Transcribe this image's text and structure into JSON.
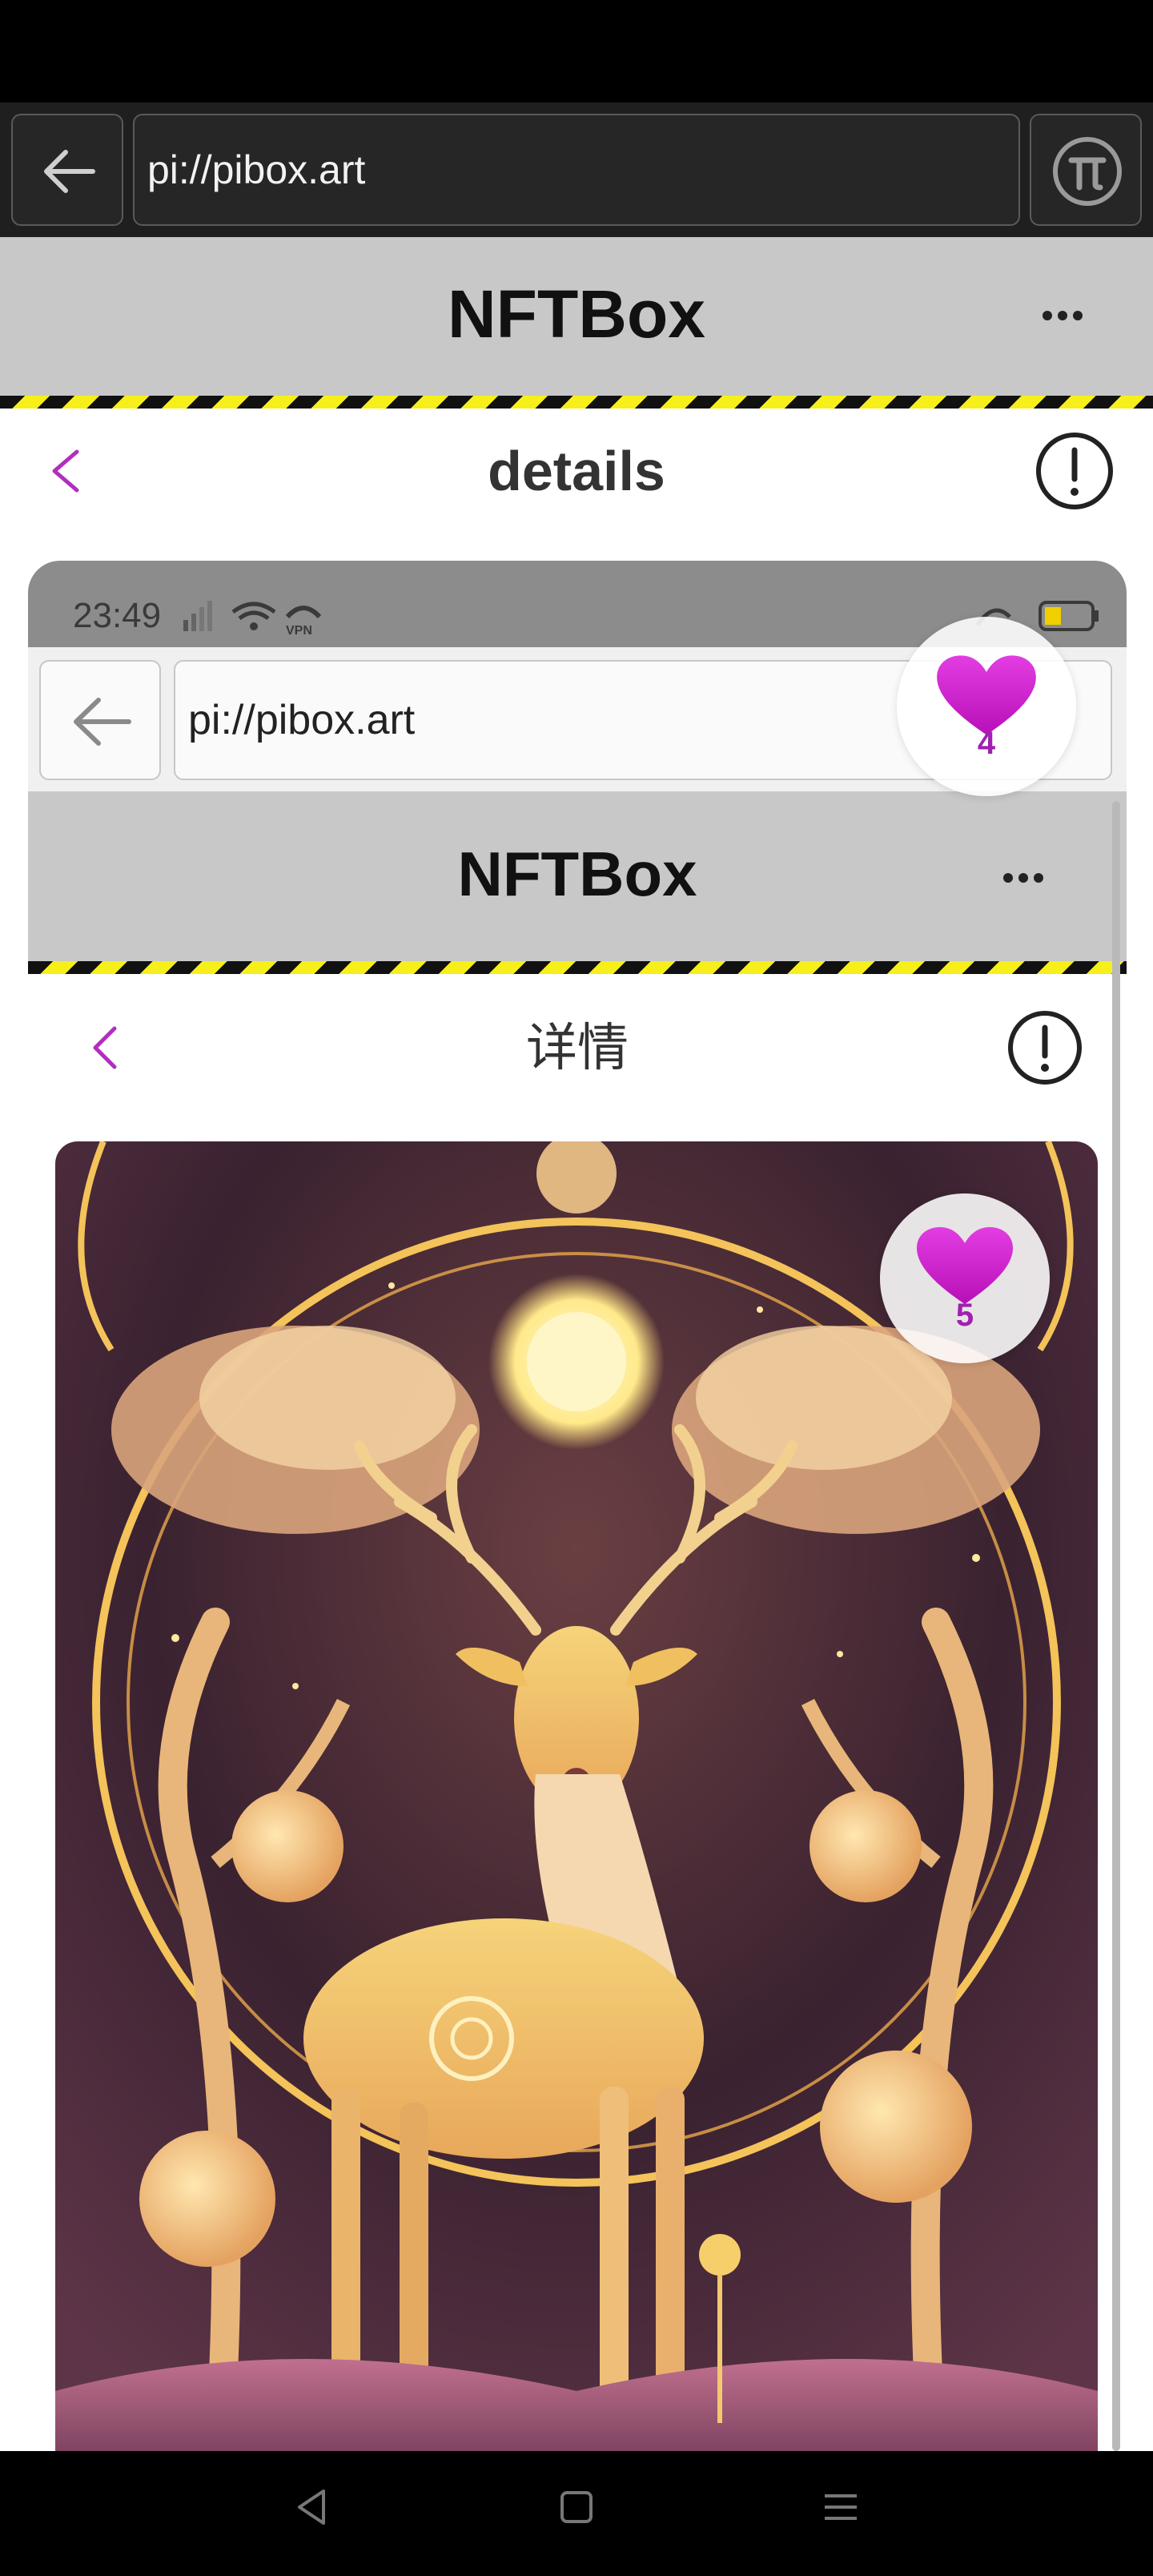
{
  "browser": {
    "url": "pi://pibox.art"
  },
  "app": {
    "title": "NFTBox",
    "page_title": "details"
  },
  "inner_screenshot": {
    "time": "23:49",
    "url": "pi://pibox.art",
    "app_title": "NFTBox",
    "page_title": "详情",
    "like_count": "5"
  },
  "floating_like": {
    "count": "4"
  },
  "colors": {
    "accent": "#c020c0",
    "header_gray": "#c8c8c8",
    "hazard_yellow": "#f6ef1a"
  }
}
